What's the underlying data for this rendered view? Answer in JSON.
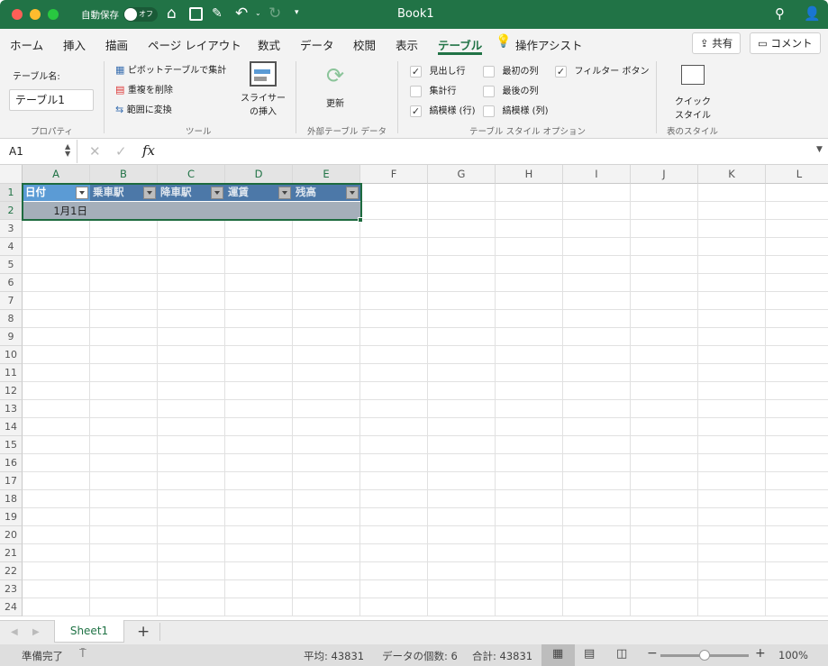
{
  "titlebar": {
    "autosave_label": "自動保存",
    "autosave_state": "オフ",
    "title": "Book1"
  },
  "menu_tabs": [
    "ホーム",
    "挿入",
    "描画",
    "ページ レイアウト",
    "数式",
    "データ",
    "校閲",
    "表示",
    "テーブル"
  ],
  "active_tab": "テーブル",
  "tell_me": "操作アシスト",
  "share_label": "共有",
  "comment_label": "コメント",
  "ribbon": {
    "properties": {
      "name_label": "テーブル名:",
      "name_value": "テーブル1",
      "group": "プロパティ"
    },
    "tools": {
      "pivot": "ピボットテーブルで集計",
      "remove_dup": "重複を削除",
      "convert": "範囲に変換",
      "slicer_1": "スライサー",
      "slicer_2": "の挿入",
      "group": "ツール"
    },
    "external": {
      "refresh": "更新",
      "group": "外部テーブル データ"
    },
    "options": {
      "items": [
        {
          "label": "見出し行",
          "checked": true
        },
        {
          "label": "集計行",
          "checked": false
        },
        {
          "label": "縞模様 (行)",
          "checked": true
        },
        {
          "label": "最初の列",
          "checked": false
        },
        {
          "label": "最後の列",
          "checked": false
        },
        {
          "label": "縞模様 (列)",
          "checked": false
        },
        {
          "label": "フィルター ボタン",
          "checked": true
        }
      ],
      "group": "テーブル スタイル オプション"
    },
    "styles": {
      "quick_1": "クイック",
      "quick_2": "スタイル",
      "group": "表のスタイル"
    }
  },
  "formula": {
    "name_box": "A1",
    "fx": "fx",
    "value": ""
  },
  "grid": {
    "columns": [
      "A",
      "B",
      "C",
      "D",
      "E",
      "F",
      "G",
      "H",
      "I",
      "J",
      "K",
      "L"
    ],
    "row_count": 24,
    "selected_cols": 5,
    "selected_rows": 2,
    "table_headers": [
      "日付",
      "乗車駅",
      "降車駅",
      "運賃",
      "残高"
    ],
    "row2": [
      "1月1日",
      "",
      "",
      "",
      ""
    ]
  },
  "sheets": [
    "Sheet1"
  ],
  "add_sheet": "+",
  "status": {
    "ready": "準備完了",
    "average": "平均: 43831",
    "count": "データの個数: 6",
    "sum": "合計: 43831",
    "zoom": "100%",
    "zoom_fraction": 0.5
  }
}
